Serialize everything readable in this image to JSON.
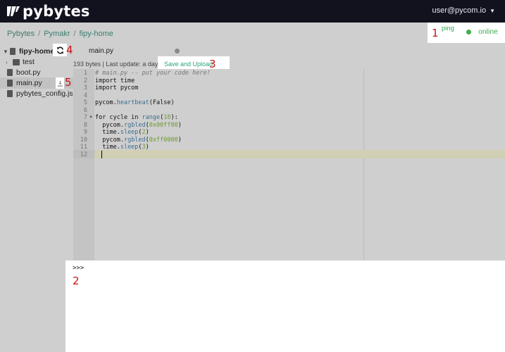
{
  "header": {
    "logo_text": "pybytes",
    "user": "user@pycom.io"
  },
  "breadcrumb": [
    "Pybytes",
    "Pymakr",
    "fipy-home"
  ],
  "device": {
    "ping_label": "ping",
    "status": "online",
    "status_color": "#3fae52"
  },
  "file_tree": {
    "root": "fipy-home",
    "items": [
      {
        "name": "test",
        "type": "folder"
      },
      {
        "name": "boot.py",
        "type": "file"
      },
      {
        "name": "main.py",
        "type": "file",
        "selected": true
      },
      {
        "name": "pybytes_config.jso",
        "type": "file"
      }
    ]
  },
  "editor": {
    "tab_label": "main.py",
    "meta": "193 bytes | Last update: a day ago",
    "save_label": "Save and Upload",
    "line_numbers": [
      "1",
      "2",
      "3",
      "4",
      "5",
      "6",
      "7",
      "8",
      "9",
      "10",
      "11",
      "12"
    ],
    "code_lines": [
      "# main.py -- put your code here!",
      "import time",
      "import pycom",
      "",
      "pycom.heartbeat(False)",
      "",
      "for cycle in range(10):",
      "  pycom.rgbled(0x00ff00)",
      "  time.sleep(2)",
      "  pycom.rgbled(0xff0000)",
      "  time.sleep(3)",
      ""
    ]
  },
  "terminal": {
    "prompt": ">>>"
  },
  "annotations": [
    "1",
    "2",
    "3",
    "4",
    "5"
  ],
  "colors": {
    "accent": "#2aa57e",
    "annotation": "#cc1111",
    "topbar": "#12121f"
  }
}
